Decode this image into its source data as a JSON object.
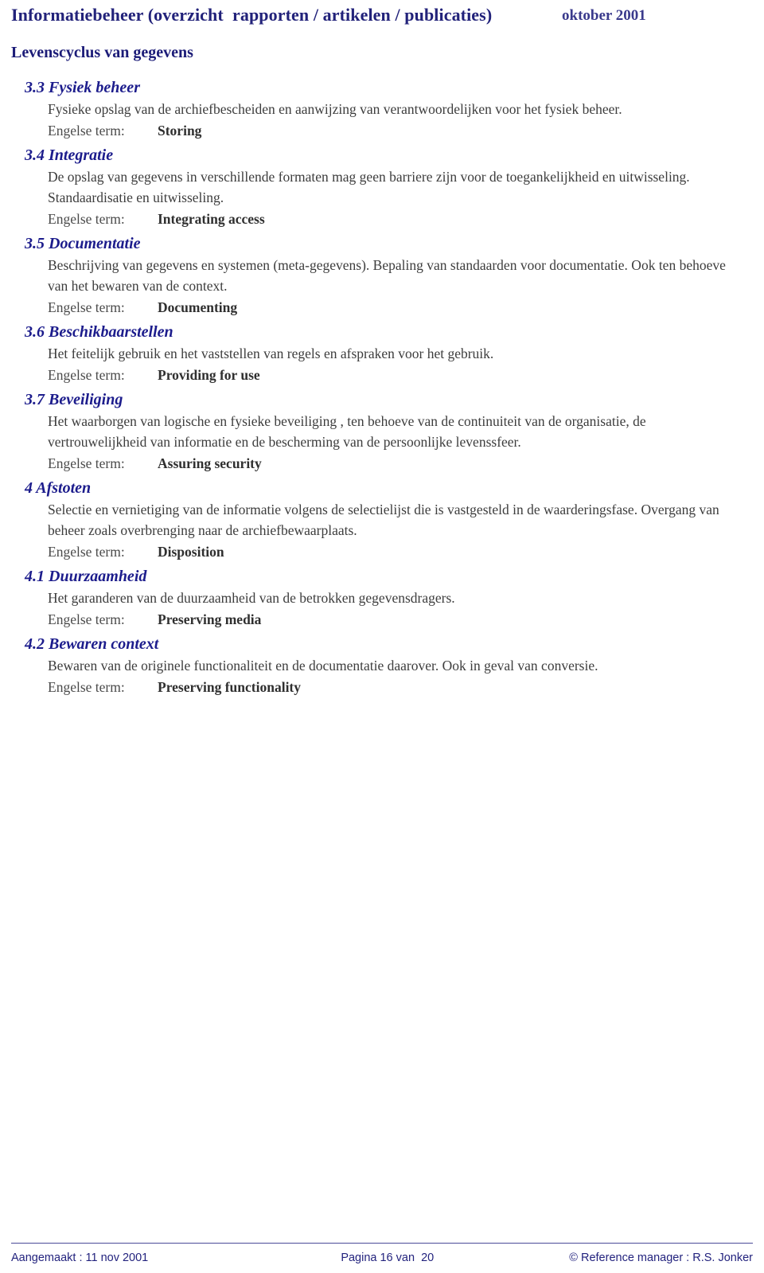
{
  "header": {
    "title": "Informatiebeheer (overzicht  rapporten / artikelen / publicaties)",
    "date": "oktober 2001"
  },
  "document": {
    "subtitle": "Levenscyclus van gegevens",
    "term_label": "Engelse term:"
  },
  "colors": {
    "heading_navy": "#1c1c8c",
    "header_navy": "#22227a",
    "footer_navy": "#23237e",
    "body_text": "#3d3d3d",
    "page_background": "#ffffff"
  },
  "sections": [
    {
      "heading": "3.3 Fysiek beheer",
      "description": "Fysieke opslag van de archiefbescheiden en aanwijzing van verantwoordelijken voor het fysiek beheer.",
      "term_label": "Engelse term:",
      "term_value": "Storing"
    },
    {
      "heading": "3.4 Integratie",
      "description": "De opslag van gegevens in verschillende formaten mag geen barriere zijn voor de toegankelijkheid en uitwisseling. Standaardisatie en uitwisseling.",
      "term_label": "Engelse term:",
      "term_value": "Integrating access"
    },
    {
      "heading": "3.5 Documentatie",
      "description": "Beschrijving van gegevens en systemen (meta-gegevens). Bepaling van standaarden voor documentatie. Ook ten behoeve van het bewaren van de context.",
      "term_label": "Engelse term:",
      "term_value": "Documenting"
    },
    {
      "heading": "3.6 Beschikbaarstellen",
      "description": "Het feitelijk gebruik en het vaststellen van regels en afspraken voor het gebruik.",
      "term_label": "Engelse term:",
      "term_value": "Providing for use"
    },
    {
      "heading": "3.7 Beveiliging",
      "description": "Het waarborgen van logische en fysieke beveiliging , ten behoeve van de continuiteit van de organisatie, de vertrouwelijkheid van informatie en de bescherming van de persoonlijke levenssfeer.",
      "term_label": "Engelse term:",
      "term_value": "Assuring security"
    },
    {
      "heading": "4 Afstoten",
      "description": "Selectie en vernietiging van de informatie volgens de selectielijst die is vastgesteld in de waarderingsfase. Overgang van beheer zoals overbrenging naar de archiefbewaarplaats.",
      "term_label": "Engelse term:",
      "term_value": "Disposition"
    },
    {
      "heading": "4.1 Duurzaamheid",
      "description": "Het garanderen van de duurzaamheid van de betrokken gegevensdragers.",
      "term_label": "Engelse term:",
      "term_value": "Preserving media"
    },
    {
      "heading": "4.2 Bewaren context",
      "description": "Bewaren van de originele functionaliteit en de documentatie daarover. Ook in geval van conversie.",
      "term_label": "Engelse term:",
      "term_value": "Preserving functionality"
    }
  ],
  "footer": {
    "created": "Aangemaakt : 11 nov 2001",
    "page": "Pagina 16 van  20",
    "copyright": "© Reference manager : R.S. Jonker"
  }
}
